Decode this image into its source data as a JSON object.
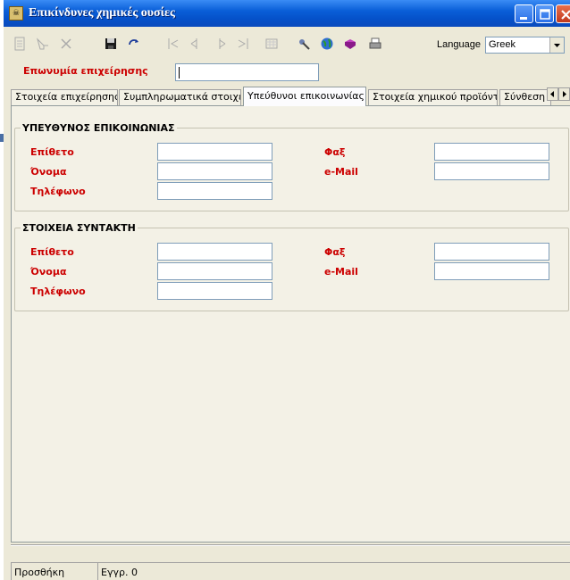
{
  "window": {
    "title": "Επικίνδυνες χημικές ουσίες"
  },
  "toolbar": {
    "icons": [
      "new-icon",
      "edit-icon",
      "delete-icon",
      "save-icon",
      "refresh-icon",
      "first-record-icon",
      "previous-record-icon",
      "next-record-icon",
      "last-record-icon",
      "grid-icon",
      "tools-icon",
      "globe-icon",
      "book-icon",
      "printer-icon"
    ],
    "language_label": "Language",
    "language_value": "Greek"
  },
  "company": {
    "label": "Επωνυμία επιχείρησης",
    "value": ""
  },
  "tabs": [
    {
      "label": "Στοιχεία επιχείρησης",
      "active": false
    },
    {
      "label": "Συμπληρωματικά στοιχεία",
      "active": false
    },
    {
      "label": "Υπεύθυνοι επικοινωνίας",
      "active": true
    },
    {
      "label": "Στοιχεία χημικού προϊόντος",
      "active": false
    },
    {
      "label": "Σύνθεση",
      "active": false
    }
  ],
  "contact": {
    "title": "ΥΠΕΥΘΥΝΟΣ ΕΠΙΚΟΙΝΩΝΙΑΣ",
    "surname_label": "Επίθετο",
    "name_label": "Όνομα",
    "phone_label": "Τηλέφωνο",
    "fax_label": "Φαξ",
    "email_label": "e-Mail"
  },
  "editor": {
    "title": "ΣΤΟΙΧΕΙΑ ΣΥΝΤΑΚΤΗ",
    "surname_label": "Επίθετο",
    "name_label": "Όνομα",
    "phone_label": "Τηλέφωνο",
    "fax_label": "Φαξ",
    "email_label": "e-Mail"
  },
  "status": {
    "mode": "Προσθήκη",
    "record": "Εγγρ. 0"
  },
  "colors": {
    "label_red": "#cc0000",
    "titlebar_blue": "#0a5fd8"
  }
}
